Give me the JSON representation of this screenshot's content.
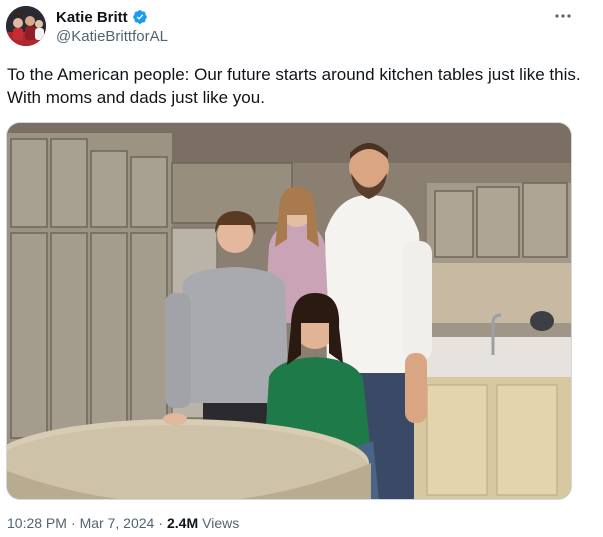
{
  "author": {
    "display_name": "Katie Britt",
    "handle": "@KatieBrittforAL",
    "verified": true,
    "avatar_icon": "profile-photo"
  },
  "tweet": {
    "text": "To the American people: Our future starts around kitchen tables just like this. With moms and dads just like you.",
    "media_icon": "family-kitchen-photo"
  },
  "meta": {
    "time": "10:28 PM",
    "separator": "·",
    "date": "Mar 7, 2024",
    "views_count": "2.4M",
    "views_label": "Views"
  },
  "colors": {
    "verified_blue": "#1d9bf0",
    "secondary_text": "#536471",
    "primary_text": "#0f1419"
  }
}
